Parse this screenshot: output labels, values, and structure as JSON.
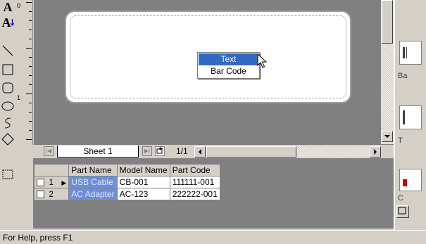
{
  "toolbox": {
    "text_tool": "A",
    "vertical_text_tool": "A"
  },
  "ruler": {
    "marks": [
      "0",
      "1"
    ]
  },
  "context_menu": {
    "items": [
      {
        "label": "Text",
        "selected": true
      },
      {
        "label": "Bar Code",
        "selected": false
      }
    ]
  },
  "sheet_bar": {
    "sheet_tab": "Sheet 1",
    "page_indicator": "1/1"
  },
  "grid": {
    "columns": [
      "Part Name",
      "Model Name",
      "Part Code"
    ],
    "rows": [
      {
        "num": "1",
        "part_name": "USB Cable",
        "model_name": "CB-001",
        "part_code": "111111-001",
        "current": true
      },
      {
        "num": "2",
        "part_name": "AC Adapter",
        "model_name": "AC-123",
        "part_code": "222222-001",
        "current": false
      }
    ]
  },
  "right_panel": {
    "labels": [
      "Ba",
      "T",
      "C"
    ]
  },
  "status_bar": {
    "text": "For Help, press F1"
  },
  "colors": {
    "selection": "#316ac5",
    "highlight_cell": "#6d8fdb",
    "canvas_bg": "#808080",
    "window_bg": "#d4d0c8"
  }
}
